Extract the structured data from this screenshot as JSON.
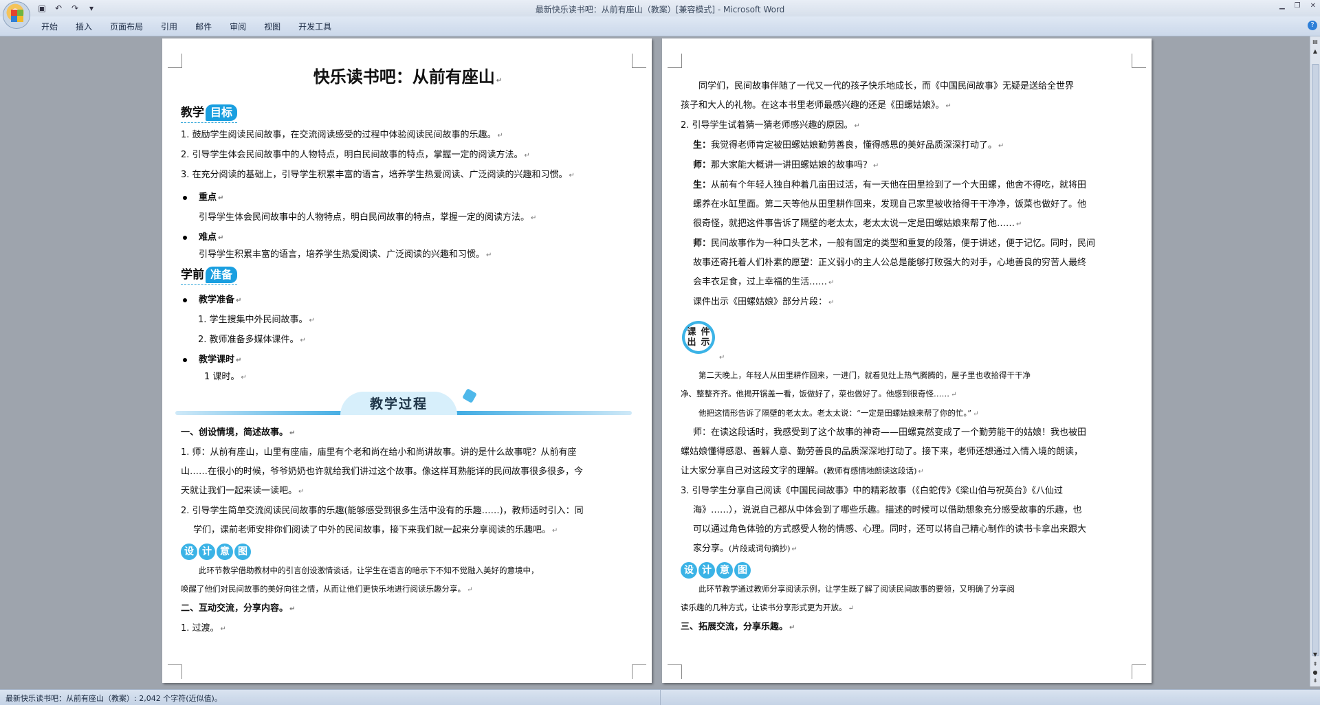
{
  "window": {
    "title": "最新快乐读书吧：从前有座山（教案）[兼容模式] - Microsoft Word"
  },
  "qat": {
    "save_icon": "save-icon",
    "undo_icon": "undo-icon",
    "redo_icon": "redo-icon"
  },
  "ribbon": {
    "tabs": [
      "开始",
      "插入",
      "页面布局",
      "引用",
      "邮件",
      "审阅",
      "视图",
      "开发工具"
    ]
  },
  "page_left": {
    "title": "快乐读书吧：从前有座山",
    "goals_head": {
      "plain": "教学",
      "tag": "目标"
    },
    "goals": [
      "1. 鼓励学生阅读民间故事，在交流阅读感受的过程中体验阅读民间故事的乐趣。",
      "2. 引导学生体会民间故事中的人物特点，明白民间故事的特点，掌握一定的阅读方法。",
      "3. 在充分阅读的基础上，引导学生积累丰富的语言，培养学生热爱阅读、广泛阅读的兴趣和习惯。"
    ],
    "key_point_label": "重点",
    "key_point": "引导学生体会民间故事中的人物特点，明白民间故事的特点，掌握一定的阅读方法。",
    "difficulty_label": "难点",
    "difficulty": "引导学生积累丰富的语言，培养学生热爱阅读、广泛阅读的兴趣和习惯。",
    "prep_head": {
      "plain": "学前",
      "tag": "准备"
    },
    "prep_label": "教学准备",
    "prep_items": [
      "1. 学生搜集中外民间故事。",
      "2. 教师准备多媒体课件。"
    ],
    "hours_label": "教学课时",
    "hours": "1 课时。",
    "process_banner": "教学过程",
    "sec1": "一、创设情境，简述故事。",
    "p1_1": "1. 师：从前有座山，山里有座庙，庙里有个老和尚在给小和尚讲故事。讲的是什么故事呢？从前有座",
    "p1_2": "山……在很小的时候，爷爷奶奶也许就给我们讲过这个故事。像这样耳熟能详的民间故事很多很多，今",
    "p1_3": "天就让我们一起来读一读吧。",
    "p2_1": "2. 引导学生简单交流阅读民间故事的乐趣(能够感受到很多生活中没有的乐趣……)，教师适时引入：同",
    "p2_2": "学们，课前老师安排你们阅读了中外的民间故事，接下来我们就一起来分享阅读的乐趣吧。",
    "design_chars": [
      "设",
      "计",
      "意",
      "图"
    ],
    "design_1": "此环节教学借助教材中的引言创设激情谈话，让学生在语言的暗示下不知不觉融入美好的意境中，",
    "design_2": "唤醒了他们对民间故事的美好向往之情，从而让他们更快乐地进行阅读乐趣分享。",
    "sec2": "二、互动交流，分享内容。",
    "transition": "1. 过渡。"
  },
  "page_right": {
    "r1_1": "同学们，民间故事伴随了一代又一代的孩子快乐地成长，而《中国民间故事》无疑是送给全世界",
    "r1_2": "孩子和大人的礼物。在这本书里老师最感兴趣的还是《田螺姑娘》。",
    "r2": "2. 引导学生试着猜一猜老师感兴趣的原因。",
    "r3": {
      "speaker": "生：",
      "text": "我觉得老师肯定被田螺姑娘勤劳善良，懂得感恩的美好品质深深打动了。"
    },
    "r4": {
      "speaker": "师：",
      "text": "那大家能大概讲一讲田螺姑娘的故事吗？"
    },
    "r5": {
      "speaker": "生：",
      "l1": "从前有个年轻人独自种着几亩田过活，有一天他在田里捡到了一个大田螺，他舍不得吃，就将田",
      "l2": "螺养在水缸里面。第二天等他从田里耕作回来，发现自己家里被收拾得干干净净，饭菜也做好了。他",
      "l3": "很奇怪，就把这件事告诉了隔壁的老太太，老太太说一定是田螺姑娘来帮了他……"
    },
    "r6": {
      "speaker": "师：",
      "l1": "民间故事作为一种口头艺术，一般有固定的类型和重复的段落，便于讲述，便于记忆。同时，民间",
      "l2": "故事还寄托着人们朴素的愿望：正义弱小的主人公总是能够打败强大的对手，心地善良的穷苦人最终",
      "l3": "会丰衣足食，过上幸福的生活……"
    },
    "r7": "课件出示《田螺姑娘》部分片段：",
    "kejian_chars": [
      "课",
      "件",
      "出",
      "示"
    ],
    "excerpt_1": "第二天晚上，年轻人从田里耕作回来，一进门，就看见灶上热气腾腾的，屋子里也收拾得干干净",
    "excerpt_2": "净、整整齐齐。他揭开锅盖一看，饭做好了，菜也做好了。他感到很奇怪……",
    "excerpt_3": "他把这情形告诉了隔壁的老太太。老太太说：“一定是田螺姑娘来帮了你的忙。”",
    "r8_1": "师：在读这段话时，我感受到了这个故事的神奇——田螺竟然变成了一个勤劳能干的姑娘！我也被田",
    "r8_2": "螺姑娘懂得感恩、善解人意、勤劳善良的品质深深地打动了。接下来，老师还想通过入情入境的朗读，",
    "r8_3": "让大家分享自己对这段文字的理解。",
    "r8_note": "(教师有感情地朗读这段话)",
    "r9_1": "3. 引导学生分享自己阅读《中国民间故事》中的精彩故事（《白蛇传》《梁山伯与祝英台》《八仙过",
    "r9_2": "海》……），说说自己都从中体会到了哪些乐趣。描述的时候可以借助想象充分感受故事的乐趣，也",
    "r9_3": "可以通过角色体验的方式感受人物的情感、心理。同时，还可以将自己精心制作的读书卡拿出来跟大",
    "r9_4": "家分享。",
    "r9_note": "(片段或词句摘抄)",
    "design_chars": [
      "设",
      "计",
      "意",
      "图"
    ],
    "design_1": "此环节教学通过教师分享阅读示例，让学生既了解了阅读民间故事的要领，又明确了分享阅",
    "design_2": "读乐趣的几种方式，让读书分享形式更为开放。",
    "sec3": "三、拓展交流，分享乐趣。"
  },
  "status": {
    "text": "最新快乐读书吧：从前有座山（教案）: 2,042 个字符(近似值)。"
  },
  "para_mark": "↵",
  "colors": {
    "accent": "#1a9fe0",
    "workspace": "#9ea4ad"
  }
}
